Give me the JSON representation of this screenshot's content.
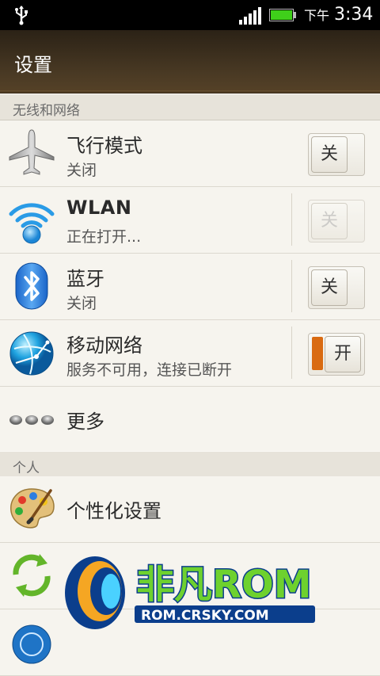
{
  "status_bar": {
    "usb_icon": "usb-icon",
    "signal_icon": "signal-bars-icon",
    "battery_icon": "battery-icon",
    "ampm": "下午",
    "time": "3:34"
  },
  "header": {
    "title": "设置"
  },
  "sections": {
    "wireless": "无线和网络",
    "personal": "个人"
  },
  "rows": {
    "airplane": {
      "title": "飞行模式",
      "subtitle": "关闭",
      "toggle": "关",
      "icon": "airplane-icon"
    },
    "wlan": {
      "title": "WLAN",
      "subtitle": "正在打开...",
      "toggle": "关",
      "icon": "wifi-icon"
    },
    "bluetooth": {
      "title": "蓝牙",
      "subtitle": "关闭",
      "toggle": "关",
      "icon": "bluetooth-icon"
    },
    "mobile": {
      "title": "移动网络",
      "subtitle": "服务不可用，连接已断开",
      "toggle": "开",
      "icon": "globe-network-icon"
    },
    "more": {
      "title": "更多",
      "icon": "more-dots-icon"
    },
    "personalize": {
      "title": "个性化设置",
      "icon": "palette-icon"
    }
  },
  "watermark": {
    "brand": "非凡ROM",
    "url": "ROM.CRSKY.COM"
  },
  "colors": {
    "toggle_on": "#d96b12",
    "header_brown": "#4a3a24"
  }
}
